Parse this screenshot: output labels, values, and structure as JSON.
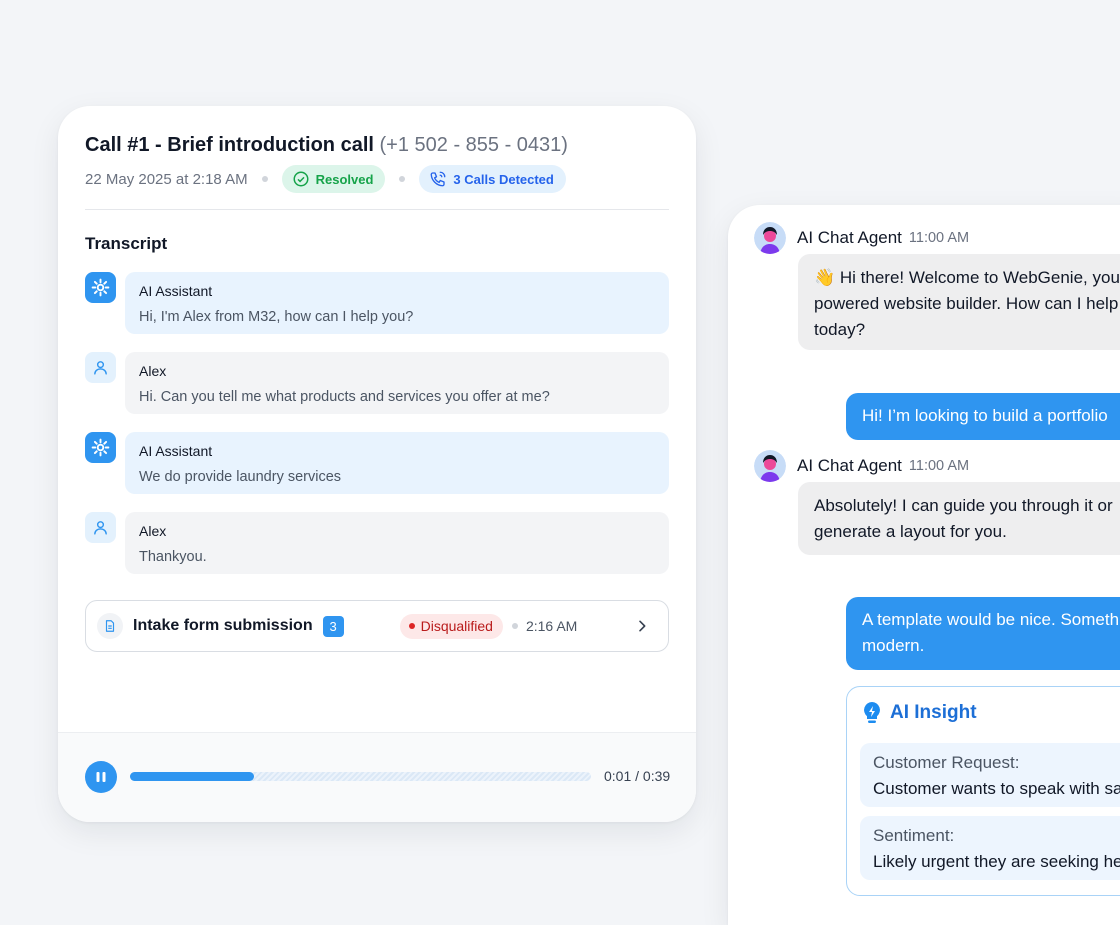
{
  "call": {
    "title": "Call #1 - Brief introduction call",
    "phone": "(+1 502 - 855 - 0431)",
    "date": "22 May 2025 at 2:18 AM",
    "status": "Resolved",
    "calls_detected": "3 Calls Detected",
    "transcript_title": "Transcript",
    "messages": [
      {
        "speaker": "AI Assistant",
        "text": "Hi, I'm Alex from M32, how can I help you?"
      },
      {
        "speaker": "Alex",
        "text": "Hi. Can you tell me what products and services you offer at me?"
      },
      {
        "speaker": "AI Assistant",
        "text": "We do provide laundry services"
      },
      {
        "speaker": "Alex",
        "text": "Thankyou."
      }
    ],
    "form": {
      "label": "Intake form submission",
      "count": "3",
      "status": "Disqualified",
      "time": "2:16 AM"
    },
    "player": {
      "time": "0:01 / 0:39",
      "progress_percent": 27
    }
  },
  "chat": {
    "agent_name": "AI Chat Agent",
    "messages": [
      {
        "time": "11:00 AM",
        "text": "👋 Hi there! Welcome to WebGenie, your AI-powered website builder. How can I help you today?"
      },
      {
        "user_text": "Hi! I’m looking to build a portfolio"
      },
      {
        "time": "11:00 AM",
        "text": "Absolutely! I can guide you through it or generate a layout for you."
      },
      {
        "user_text": "A template would be nice. Something modern."
      }
    ],
    "insight": {
      "title": "AI Insight",
      "items": [
        {
          "label": "Customer Request:",
          "value": "Customer wants to speak with sales"
        },
        {
          "label": "Sentiment:",
          "value": "Likely urgent they are seeking help"
        }
      ]
    }
  },
  "colors": {
    "accent": "#2f95f0",
    "resolved": "#16a34a",
    "disqualified": "#b91c1c",
    "insight": "#1d6fd6"
  }
}
